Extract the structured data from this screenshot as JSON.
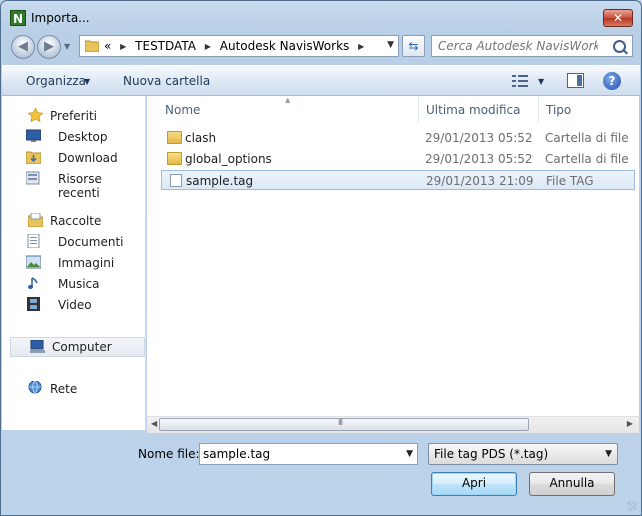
{
  "window": {
    "title": "Importa...",
    "close_label": "✕"
  },
  "nav": {
    "back_icon": "back-arrow-icon",
    "forward_icon": "forward-arrow-icon",
    "address": {
      "prefix": "«",
      "segments": [
        "TESTDATA",
        "Autodesk NavisWorks"
      ]
    },
    "search_placeholder": "Cerca Autodesk NavisWorks"
  },
  "toolbar": {
    "organize_label": "Organizza",
    "new_folder_label": "Nuova cartella"
  },
  "sidebar": {
    "items": [
      {
        "label": "Preferiti",
        "icon": "star-icon",
        "kind": "head"
      },
      {
        "label": "Desktop",
        "icon": "desktop-icon",
        "kind": "child"
      },
      {
        "label": "Download",
        "icon": "download-folder-icon",
        "kind": "child"
      },
      {
        "label": "Risorse recenti",
        "icon": "recent-places-icon",
        "kind": "child"
      },
      {
        "label": "Raccolte",
        "icon": "libraries-icon",
        "kind": "head"
      },
      {
        "label": "Documenti",
        "icon": "documents-icon",
        "kind": "child"
      },
      {
        "label": "Immagini",
        "icon": "pictures-icon",
        "kind": "child"
      },
      {
        "label": "Musica",
        "icon": "music-icon",
        "kind": "child"
      },
      {
        "label": "Video",
        "icon": "video-icon",
        "kind": "child"
      },
      {
        "label": "Computer",
        "icon": "computer-icon",
        "kind": "selected"
      },
      {
        "label": "Rete",
        "icon": "network-icon",
        "kind": "head"
      }
    ]
  },
  "files": {
    "columns": {
      "name": "Nome",
      "modified": "Ultima modifica",
      "type": "Tipo"
    },
    "rows": [
      {
        "name": "clash",
        "modified": "29/01/2013 05:52",
        "type": "Cartella di file",
        "icon": "folder-icon"
      },
      {
        "name": "global_options",
        "modified": "29/01/2013 05:52",
        "type": "Cartella di file",
        "icon": "folder-icon"
      },
      {
        "name": "sample.tag",
        "modified": "29/01/2013 21:09",
        "type": "File TAG",
        "icon": "file-icon",
        "selected": true
      }
    ]
  },
  "bottom": {
    "filename_label": "Nome file:",
    "filename_value": "sample.tag",
    "filetype_value": "File tag PDS (*.tag)",
    "open_label": "Apri",
    "cancel_label": "Annulla"
  }
}
